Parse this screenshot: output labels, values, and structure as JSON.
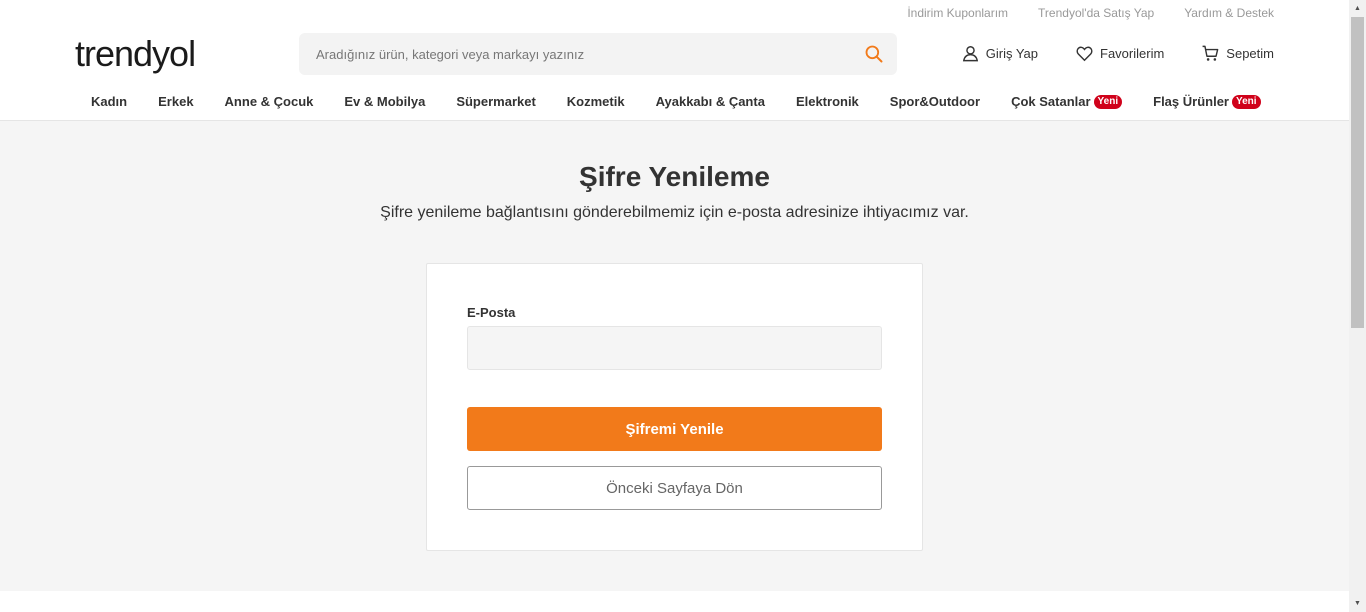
{
  "topbar": {
    "coupons": "İndirim Kuponlarım",
    "sell": "Trendyol'da Satış Yap",
    "help": "Yardım & Destek"
  },
  "header": {
    "logo": "trendyol",
    "search_placeholder": "Aradığınız ürün, kategori veya markayı yazınız",
    "search_value": "",
    "login": "Giriş Yap",
    "favorites": "Favorilerim",
    "cart": "Sepetim"
  },
  "categories": [
    {
      "label": "Kadın",
      "badge": ""
    },
    {
      "label": "Erkek",
      "badge": ""
    },
    {
      "label": "Anne & Çocuk",
      "badge": ""
    },
    {
      "label": "Ev & Mobilya",
      "badge": ""
    },
    {
      "label": "Süpermarket",
      "badge": ""
    },
    {
      "label": "Kozmetik",
      "badge": ""
    },
    {
      "label": "Ayakkabı & Çanta",
      "badge": ""
    },
    {
      "label": "Elektronik",
      "badge": ""
    },
    {
      "label": "Spor&Outdoor",
      "badge": ""
    },
    {
      "label": "Çok Satanlar",
      "badge": "Yeni"
    },
    {
      "label": "Flaş Ürünler",
      "badge": "Yeni"
    }
  ],
  "main": {
    "title": "Şifre Yenileme",
    "subtitle": "Şifre yenileme bağlantısını gönderebilmemiz için e-posta adresinize ihtiyacımız var.",
    "email_label": "E-Posta",
    "email_value": "",
    "submit_label": "Şifremi Yenile",
    "back_label": "Önceki Sayfaya Dön"
  },
  "colors": {
    "accent": "#f27a1a",
    "badge": "#d0021b"
  }
}
